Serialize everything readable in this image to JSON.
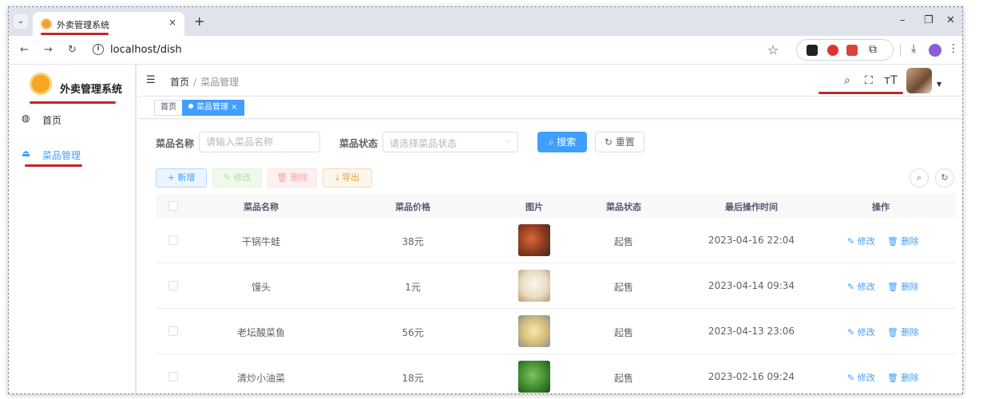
{
  "browser": {
    "tab_title": "外卖管理系统",
    "tab_close": "×",
    "new_tab": "+",
    "url": "localhost/dish"
  },
  "sidebar": {
    "app_title": "外卖管理系统",
    "items": [
      {
        "label": "首页",
        "icon": "dashboard-icon",
        "active": false
      },
      {
        "label": "菜品管理",
        "icon": "dish-icon",
        "active": true
      }
    ]
  },
  "navbar": {
    "breadcrumb": [
      "首页",
      "菜品管理"
    ],
    "separator": "/"
  },
  "tags": [
    {
      "label": "首页",
      "active": false
    },
    {
      "label": "菜品管理 ×",
      "active": true
    }
  ],
  "filters": {
    "name_label": "菜品名称",
    "name_placeholder": "请输入菜品名称",
    "status_label": "菜品状态",
    "status_placeholder": "请选择菜品状态",
    "search_button": "搜索",
    "reset_button": "重置"
  },
  "actions": {
    "add": "+ 新增",
    "edit": "修改",
    "delete": "删除",
    "export": "导出"
  },
  "table": {
    "columns": [
      "菜品名称",
      "菜品价格",
      "图片",
      "菜品状态",
      "最后操作时间",
      "操作"
    ],
    "rows": [
      {
        "name": "干锅牛蛙",
        "price": "38元",
        "status": "起售",
        "time": "2023-04-16 22:04",
        "img_color": "#8a3a1e"
      },
      {
        "name": "馒头",
        "price": "1元",
        "status": "起售",
        "time": "2023-04-14 09:34",
        "img_color": "#e9dcc4"
      },
      {
        "name": "老坛酸菜鱼",
        "price": "56元",
        "status": "起售",
        "time": "2023-04-13 23:06",
        "img_color": "#d8c27a"
      },
      {
        "name": "清炒小油菜",
        "price": "18元",
        "status": "起售",
        "time": "2023-02-16 09:24",
        "img_color": "#3f8a2e"
      }
    ],
    "row_edit": "修改",
    "row_delete": "删除"
  },
  "colors": {
    "primary": "#409eff",
    "annotation_red": "#c0272d"
  }
}
